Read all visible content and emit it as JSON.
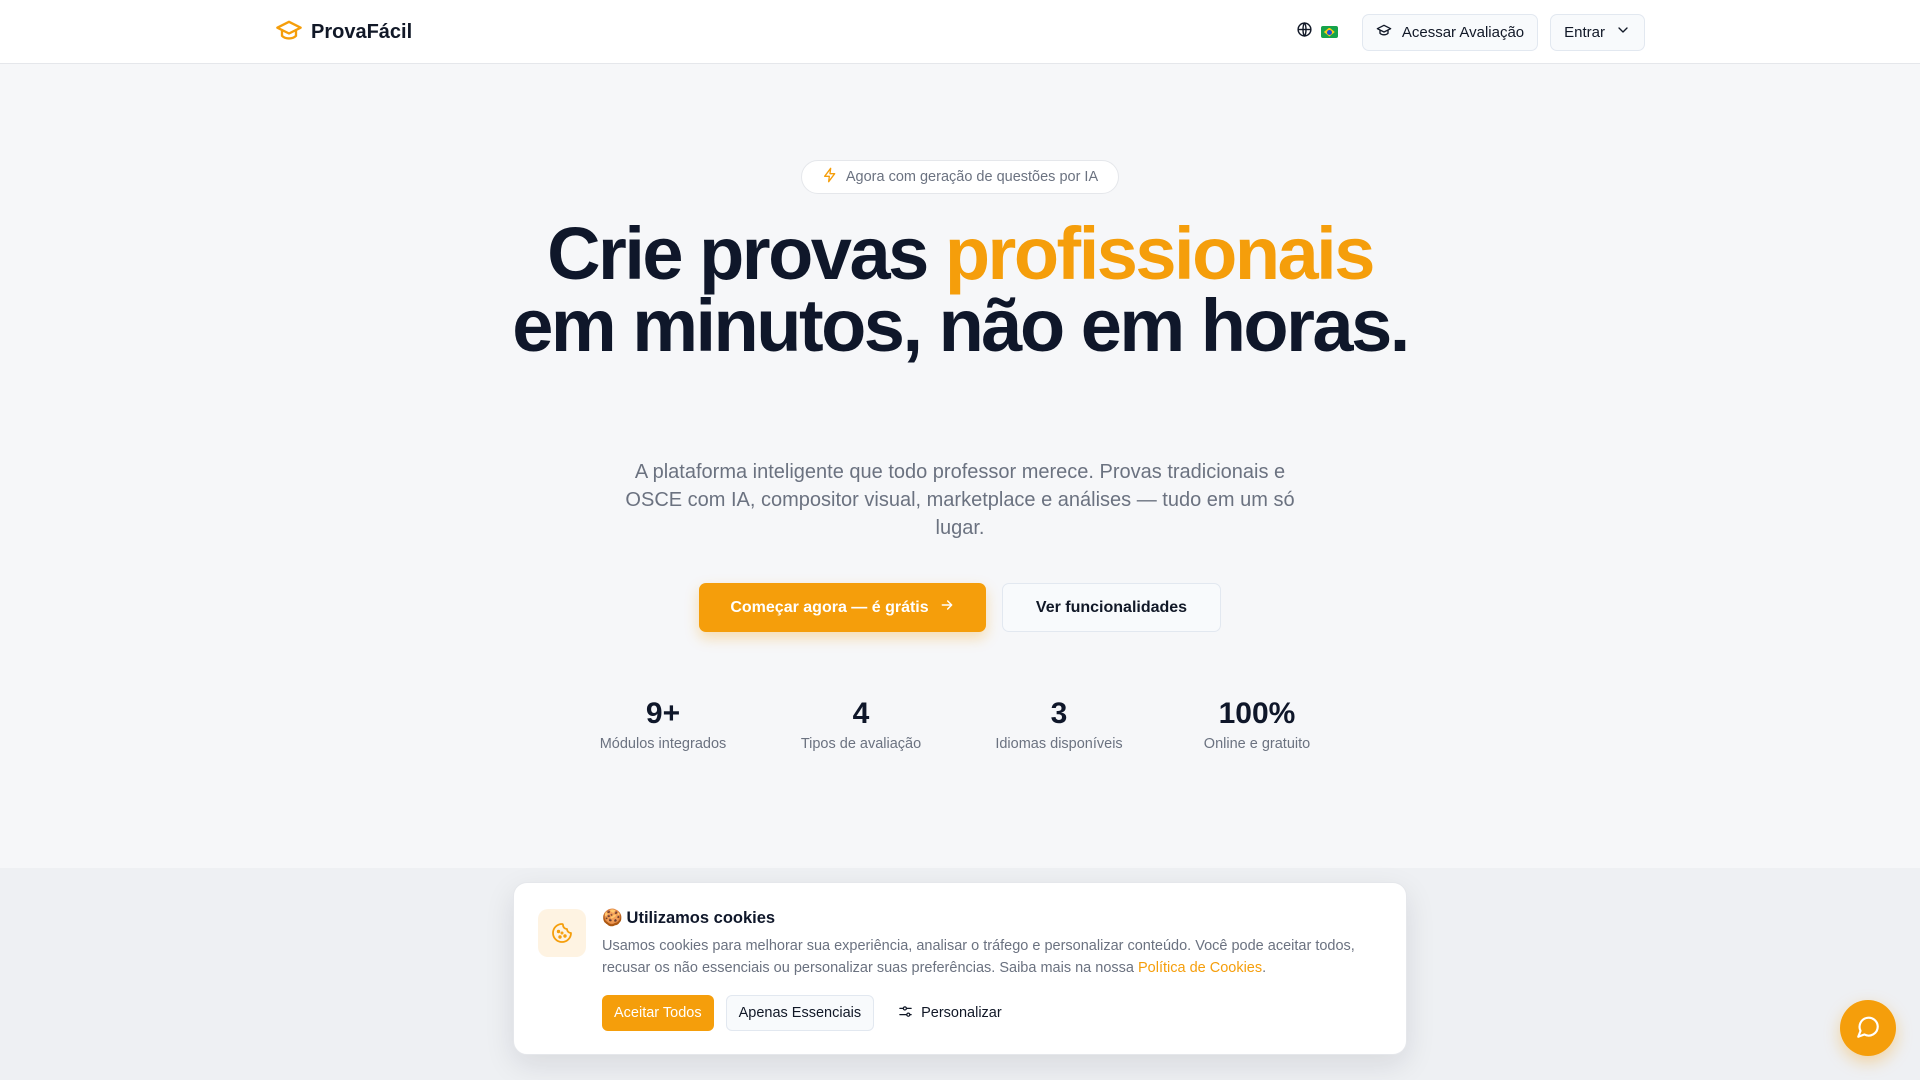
{
  "header": {
    "brand": "ProvaFácil",
    "access_label": "Acessar Avaliação",
    "signin_label": "Entrar"
  },
  "hero": {
    "badge": "Agora com geração de questões por IA",
    "title_part1": "Crie provas ",
    "title_highlight": "profissionais",
    "title_part2": "em minutos, não em horas.",
    "subtitle": "A plataforma inteligente que todo professor merece. Provas tradicionais e OSCE com IA, compositor visual, marketplace e análises — tudo em um só lugar.",
    "primary_cta": "Começar agora — é grátis",
    "secondary_cta": "Ver funcionalidades"
  },
  "stats": [
    {
      "value": "9+",
      "label": "Módulos integrados"
    },
    {
      "value": "4",
      "label": "Tipos de avaliação"
    },
    {
      "value": "3",
      "label": "Idiomas disponíveis"
    },
    {
      "value": "100%",
      "label": "Online e gratuito"
    }
  ],
  "cookie_banner": {
    "emoji": "🍪",
    "title": "Utilizamos cookies",
    "text": "Usamos cookies para melhorar sua experiência, analisar o tráfego e personalizar conteúdo. Você pode aceitar todos, recusar os não essenciais ou personalizar suas preferências. Saiba mais na nossa ",
    "link_text": "Política de Cookies",
    "text_end": ".",
    "accept_all": "Aceitar Todos",
    "essential_only": "Apenas Essenciais",
    "customize": "Personalizar"
  },
  "colors": {
    "accent": "#f59e0b",
    "background": "#f6f7f9",
    "text_primary": "#0f172a",
    "text_muted": "#6b7280"
  },
  "icons": {
    "logo": "graduation-cap-icon",
    "language": "globe-icon",
    "flag": "brazil-flag-icon",
    "access": "graduation-cap-icon",
    "signin_dropdown": "chevron-down-icon",
    "badge": "lightning-icon",
    "cta_arrow": "arrow-right-icon",
    "cookie": "cookie-icon",
    "customize": "sliders-icon",
    "chat": "message-circle-icon"
  }
}
